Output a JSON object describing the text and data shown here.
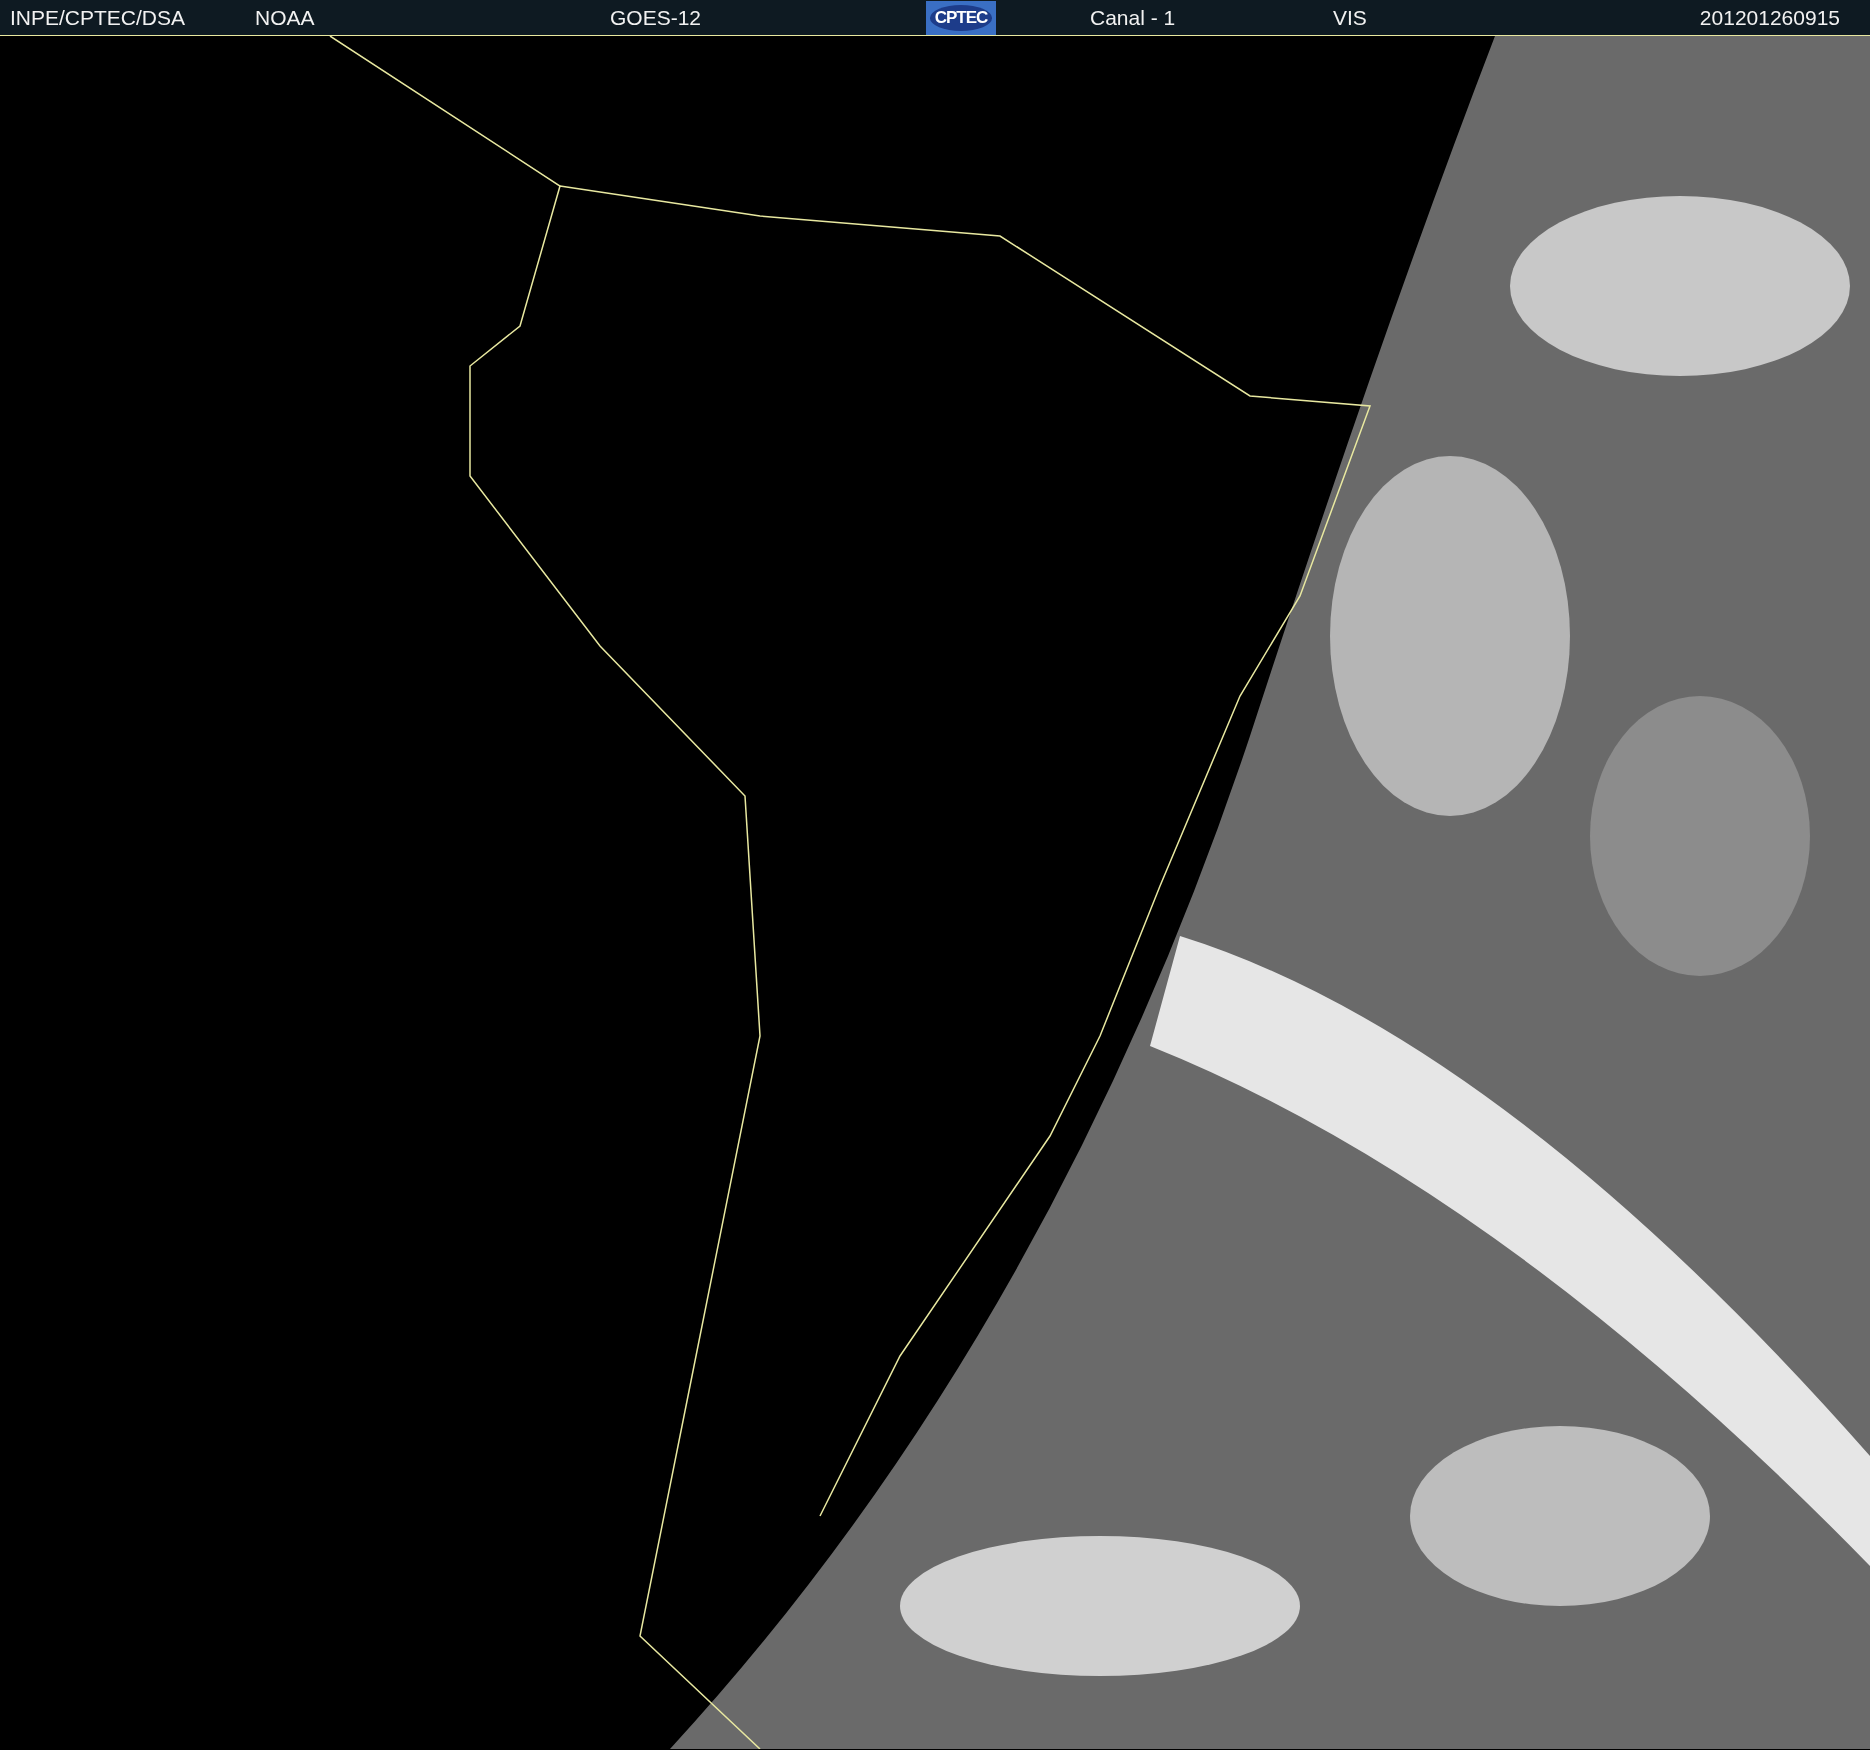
{
  "header": {
    "source": "INPE/CPTEC/DSA",
    "agency": "NOAA",
    "satellite": "GOES-12",
    "logo": "CPTEC",
    "channel": "Canal - 1",
    "band": "VIS",
    "timestamp": "201201260915"
  }
}
